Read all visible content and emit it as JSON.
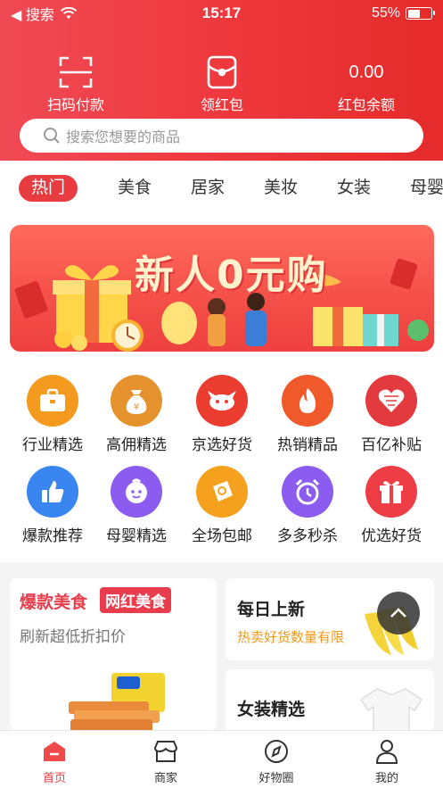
{
  "status_bar": {
    "back_label": "◀ 搜索",
    "time": "15:17",
    "battery": "55%",
    "battery_level": 0.55
  },
  "header": {
    "actions": [
      {
        "label": "扫码付款",
        "icon": "scan-icon"
      },
      {
        "label": "领红包",
        "icon": "red-envelope-icon"
      },
      {
        "label": "红包余额",
        "value": "0.00"
      }
    ],
    "search_placeholder": "搜索您想要的商品"
  },
  "category_tabs": [
    "热门",
    "美食",
    "居家",
    "美妆",
    "女装",
    "母婴"
  ],
  "active_tab": "热门",
  "banner": {
    "title": "新人0元购"
  },
  "icon_grid": [
    {
      "label": "行业精选",
      "icon": "briefcase-icon",
      "color": "#f39a1f"
    },
    {
      "label": "高佣精选",
      "icon": "money-bag-icon",
      "color": "#e5922d"
    },
    {
      "label": "京选好货",
      "icon": "jd-dog-icon",
      "color": "#ea3d2f"
    },
    {
      "label": "热销精品",
      "icon": "flame-icon",
      "color": "#f05a2a"
    },
    {
      "label": "百亿补贴",
      "icon": "heart-gift-icon",
      "color": "#e23a3f"
    },
    {
      "label": "爆款推荐",
      "icon": "thumbs-up-icon",
      "color": "#3a86f0"
    },
    {
      "label": "母婴精选",
      "icon": "baby-face-icon",
      "color": "#8c5cf0"
    },
    {
      "label": "全场包邮",
      "icon": "ticket-icon",
      "color": "#f5a11d"
    },
    {
      "label": "多多秒杀",
      "icon": "alarm-clock-icon",
      "color": "#8c5cf0"
    },
    {
      "label": "优选好货",
      "icon": "gift-box-icon",
      "color": "#ee3d44"
    }
  ],
  "cards": {
    "food": {
      "title": "爆款美食",
      "badge": "网红美食",
      "subtitle": "刷新超低折扣价"
    },
    "new_daily": {
      "title": "每日上新",
      "subtitle": "热卖好货数量有限"
    },
    "women": {
      "title": "女装精选"
    }
  },
  "bottom_nav": [
    {
      "label": "首页",
      "icon": "home-icon",
      "active": true
    },
    {
      "label": "商家",
      "icon": "shop-icon",
      "active": false
    },
    {
      "label": "好物圈",
      "icon": "compass-icon",
      "active": false
    },
    {
      "label": "我的",
      "icon": "user-icon",
      "active": false
    }
  ],
  "colors": {
    "brand_red": "#e93c40",
    "accent_orange": "#f29a1c"
  }
}
